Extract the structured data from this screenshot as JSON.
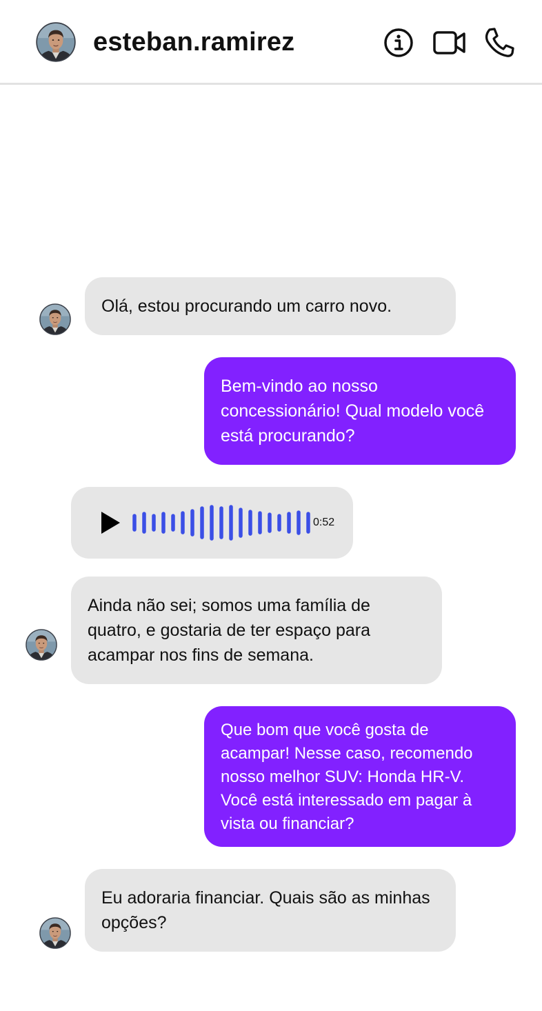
{
  "header": {
    "username": "esteban.ramirez",
    "icons": [
      "info-icon",
      "video-call-icon",
      "phone-icon"
    ]
  },
  "messages": [
    {
      "direction": "incoming",
      "text": "Olá, estou procurando um carro novo."
    },
    {
      "direction": "outgoing",
      "text": "Bem-vindo ao nosso concessionário! Qual modelo você está procurando?"
    },
    {
      "direction": "incoming",
      "type": "audio",
      "duration": "0:52"
    },
    {
      "direction": "incoming",
      "text": "Ainda não sei; somos uma família de quatro, e gostaria de ter espaço para acampar nos fins de semana."
    },
    {
      "direction": "outgoing",
      "text": "Que bom que você gosta de acampar! Nesse caso, recomendo nosso melhor SUV: Honda HR-V. Você está interessado em pagar à vista ou financiar?"
    },
    {
      "direction": "incoming",
      "text": "Eu adoraria financiar. Quais são as minhas opções?"
    }
  ],
  "colors": {
    "incoming_bubble": "#e6e6e6",
    "outgoing_bubble": "#8221ff",
    "waveform": "#3b4fe6",
    "header_border": "#e2e2e2"
  }
}
